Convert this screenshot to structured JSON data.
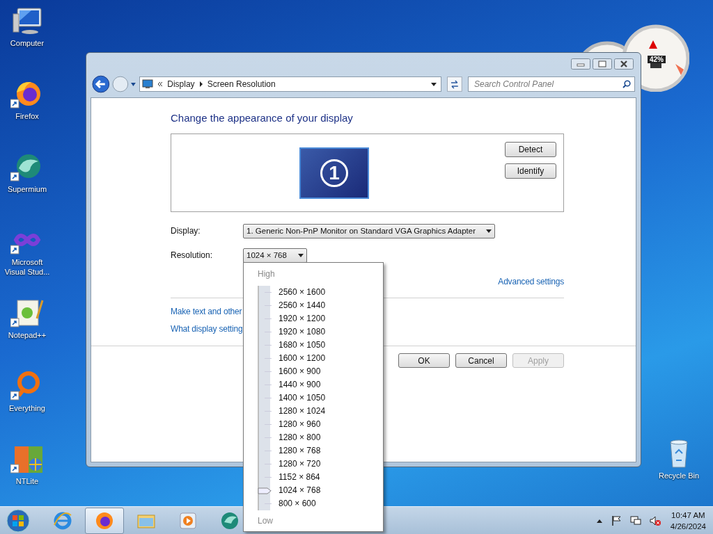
{
  "desktop_icons": [
    {
      "label": "Computer"
    },
    {
      "label": "Firefox"
    },
    {
      "label": "Supermium"
    },
    {
      "label": "Microsoft Visual Stud..."
    },
    {
      "label": "Notepad++"
    },
    {
      "label": "Everything"
    },
    {
      "label": "NTLite"
    }
  ],
  "recycle_bin": {
    "label": "Recycle Bin"
  },
  "gadget": {
    "reading": "42%"
  },
  "window": {
    "breadcrumb": [
      "Display",
      "Screen Resolution"
    ],
    "search": {
      "placeholder": "Search Control Panel"
    },
    "heading": "Change the appearance of your display",
    "monitor_number": "1",
    "side_buttons": [
      "Detect",
      "Identify"
    ],
    "fields": [
      {
        "label": "Display:",
        "value": "1. Generic Non-PnP Monitor on Standard VGA Graphics Adapter"
      },
      {
        "label": "Resolution:",
        "value": "1024 × 768"
      }
    ],
    "advanced_link": "Advanced settings",
    "links": [
      "Make text and other",
      "What display setting"
    ],
    "actions": [
      {
        "label": "OK",
        "disabled": false
      },
      {
        "label": "Cancel",
        "disabled": false
      },
      {
        "label": "Apply",
        "disabled": true
      }
    ]
  },
  "resolution_popup": {
    "high_label": "High",
    "low_label": "Low",
    "level": 0.0625,
    "options": [
      "2560 × 1600",
      "2560 × 1440",
      "1920 × 1200",
      "1920 × 1080",
      "1680 × 1050",
      "1600 × 1200",
      "1600 × 900",
      "1440 × 900",
      "1400 × 1050",
      "1280 × 1024",
      "1280 × 960",
      "1280 × 800",
      "1280 × 768",
      "1280 × 720",
      "1152 × 864",
      "1024 × 768",
      "800 × 600"
    ]
  },
  "taskbar": {
    "apps": [
      {
        "selected": false
      },
      {
        "selected": true
      },
      {
        "selected": false
      },
      {
        "selected": false
      },
      {
        "selected": false
      }
    ],
    "clock": {
      "time": "10:47 AM",
      "date": "4/26/2024"
    }
  }
}
